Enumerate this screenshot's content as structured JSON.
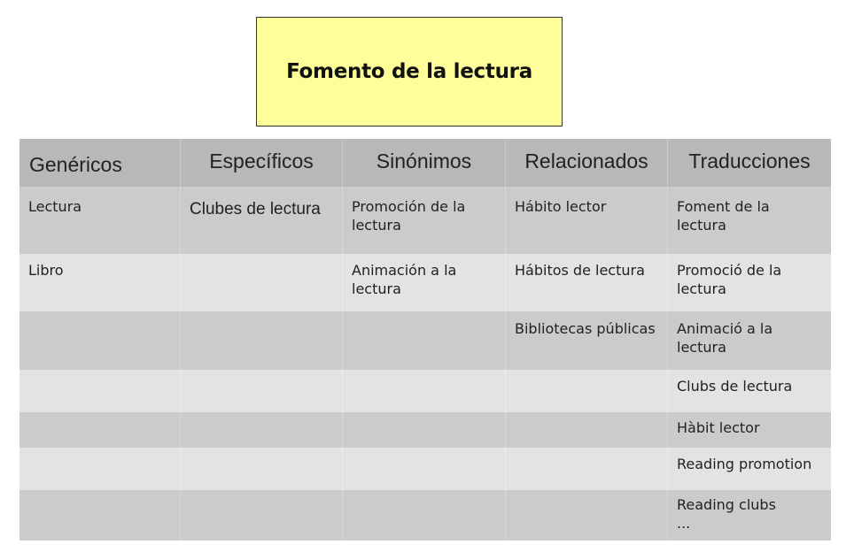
{
  "title": "Fomento de la lectura",
  "colors": {
    "title_box": "#ffff99",
    "header_row": "#b8b8b8",
    "row_dark": "#cbcbcb",
    "row_light": "#e3e3e3"
  },
  "table": {
    "headers": [
      "Genéricos",
      "Específicos",
      "Sinónimos",
      "Relacionados",
      "Traducciones"
    ],
    "rows": [
      [
        "Lectura",
        "Clubes de lectura",
        "Promoción de la lectura",
        "Hábito lector",
        "Foment de la lectura"
      ],
      [
        "Libro",
        "",
        "Animación a la lectura",
        "Hábitos de lectura",
        "Promoció de la lectura"
      ],
      [
        "",
        "",
        "",
        "Bibliotecas públicas",
        "Animació a la lectura"
      ],
      [
        "",
        "",
        "",
        "",
        "Clubs de lectura"
      ],
      [
        "",
        "",
        "",
        "",
        "Hàbit lector"
      ],
      [
        "",
        "",
        "",
        "",
        "Reading promotion"
      ],
      [
        "",
        "",
        "",
        "",
        "Reading clubs\n..."
      ]
    ]
  }
}
